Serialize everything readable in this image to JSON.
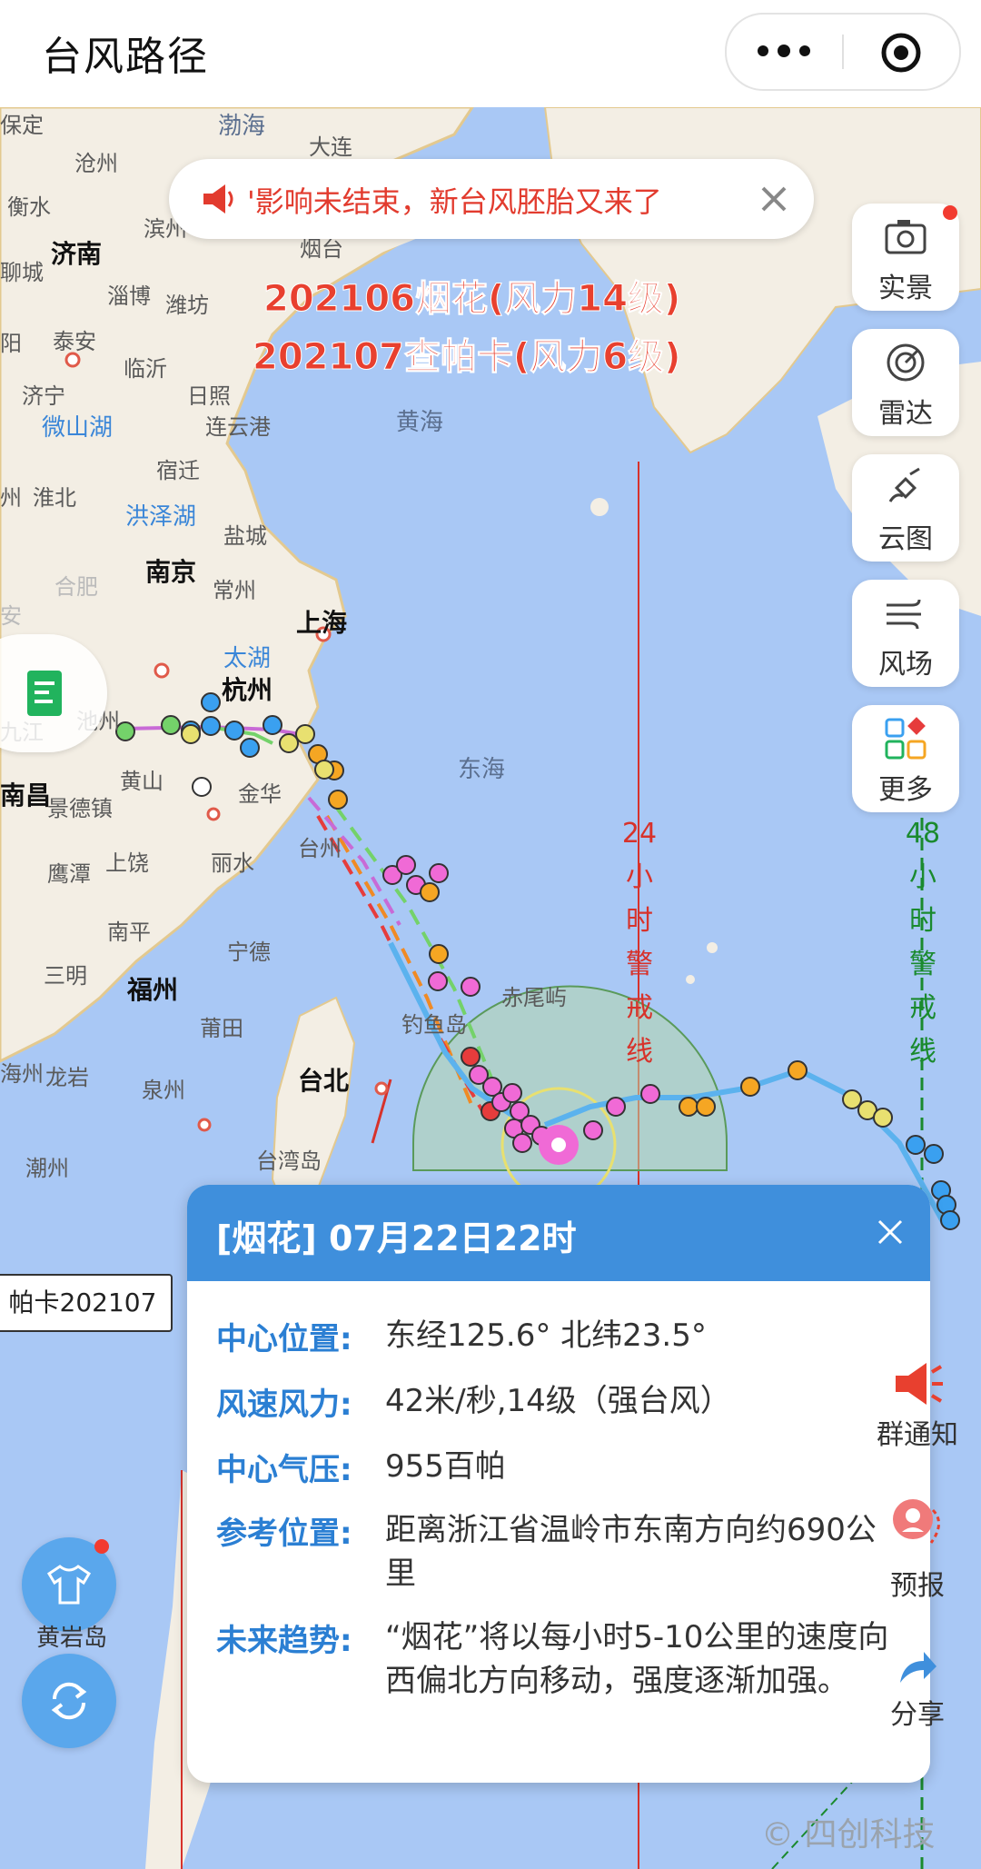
{
  "app": {
    "title": "台风路径"
  },
  "notice": {
    "text": "'影响未结束，新台风胚胎又来了"
  },
  "typhoons": [
    "202106烟花(风力14级)",
    "202107查帕卡(风力6级)"
  ],
  "tools": [
    {
      "label": "实景",
      "icon": "camera-icon"
    },
    {
      "label": "雷达",
      "icon": "radar-icon"
    },
    {
      "label": "云图",
      "icon": "satellite-icon"
    },
    {
      "label": "风场",
      "icon": "wind-icon"
    },
    {
      "label": "更多",
      "icon": "grid-more-icon"
    }
  ],
  "warning": {
    "line24": "24小时警戒线",
    "line48": "48小时警戒线",
    "color24": "#d7322b",
    "color48": "#1a8a2e"
  },
  "places": {
    "baoding": "保定",
    "bohai": "渤海",
    "dalian": "大连",
    "cangzhou": "沧州",
    "hengshui": "衡水",
    "binzhou": "滨州",
    "yantai": "烟台",
    "jinan": "济南",
    "liaocheng": "聊城",
    "zibo": "淄博",
    "weifang": "潍坊",
    "yang": "阳",
    "taian": "泰安",
    "linyi": "临沂",
    "jining": "济宁",
    "rizhao": "日照",
    "weishanhu": "微山湖",
    "lianyungang": "连云港",
    "huanghai": "黄海",
    "zhou": "州",
    "suqian": "宿迁",
    "huaibei": "淮北",
    "hongzehu": "洪泽湖",
    "yancheng": "盐城",
    "nanjing": "南京",
    "hefei": "合肥",
    "an": "安",
    "changzhou": "常州",
    "shanghai": "上海",
    "taihu": "太湖",
    "hangzhou": "杭州",
    "chizhou": "池州",
    "jiujiang": "九江",
    "huangshan": "黄山",
    "jinhua": "金华",
    "donghai": "东海",
    "chang": "南昌",
    "jingdezhen": "景德镇",
    "taizhou": "台州",
    "yingtan": "鹰潭",
    "shangrao": "上饶",
    "lishui": "丽水",
    "nanping": "南平",
    "ningde": "宁德",
    "sanming": "三明",
    "fuzhou": "福州",
    "chiweiyu": "赤尾屿",
    "diaoyudao": "钓鱼岛",
    "putian": "莆田",
    "haizhou": "海州",
    "longyan": "龙岩",
    "quanzhou": "泉州",
    "taibei": "台北",
    "chaozhou": "潮州",
    "taiwandao": "台湾岛"
  },
  "label_chapaka": "帕卡202107",
  "panel": {
    "title": "[烟花] 07月22日22时",
    "rows": [
      {
        "k": "中心位置:",
        "v": "东经125.6°   北纬23.5°"
      },
      {
        "k": "风速风力:",
        "v": "42米/秒,14级（强台风）"
      },
      {
        "k": "中心气压:",
        "v": "955百帕"
      },
      {
        "k": "参考位置:",
        "v": "距离浙江省温岭市东南方向约690公里"
      },
      {
        "k": "未来趋势:",
        "v": "“烟花”将以每小时5-10公里的速度向西偏北方向移动，强度逐渐加强。"
      }
    ]
  },
  "fabs": [
    {
      "label": "群通知",
      "icon": "megaphone-icon"
    },
    {
      "label": "预报",
      "icon": "forecast-pin-icon"
    },
    {
      "label": "分享",
      "icon": "share-icon"
    }
  ],
  "left_buttons": {
    "huangyandao": "黄岩岛"
  },
  "watermark": "© 四创科技",
  "colors": {
    "accent": "#3f8fdc",
    "sea": "#a9c8f5",
    "land": "#f3eee4",
    "track": "#5bb2ee",
    "alert": "#e23b2e"
  }
}
